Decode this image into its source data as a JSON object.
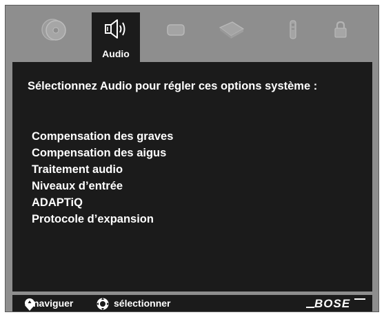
{
  "tabs": [
    {
      "icon": "disc-icon",
      "active": false
    },
    {
      "icon": "speaker-icon",
      "label": "Audio",
      "active": true
    },
    {
      "icon": "tv-icon",
      "active": false
    },
    {
      "icon": "media-box-icon",
      "active": false
    },
    {
      "icon": "remote-icon",
      "active": false
    },
    {
      "icon": "lock-icon",
      "active": false
    }
  ],
  "main": {
    "intro": "Sélectionnez Audio pour régler ces options système :",
    "options": [
      "Compensation des graves",
      "Compensation des aigus",
      "Traitement audio",
      "Niveaux d’entrée",
      "ADAPTiQ",
      "Protocole d’expansion"
    ]
  },
  "footer": {
    "navigate_label": "naviguer",
    "select_label": "sélectionner",
    "brand": "BOSE"
  },
  "colors": {
    "background": "#8e8e8e",
    "panel": "#1b1b1b",
    "text": "#ffffff",
    "inactive_icon": "#a8a8a8"
  }
}
